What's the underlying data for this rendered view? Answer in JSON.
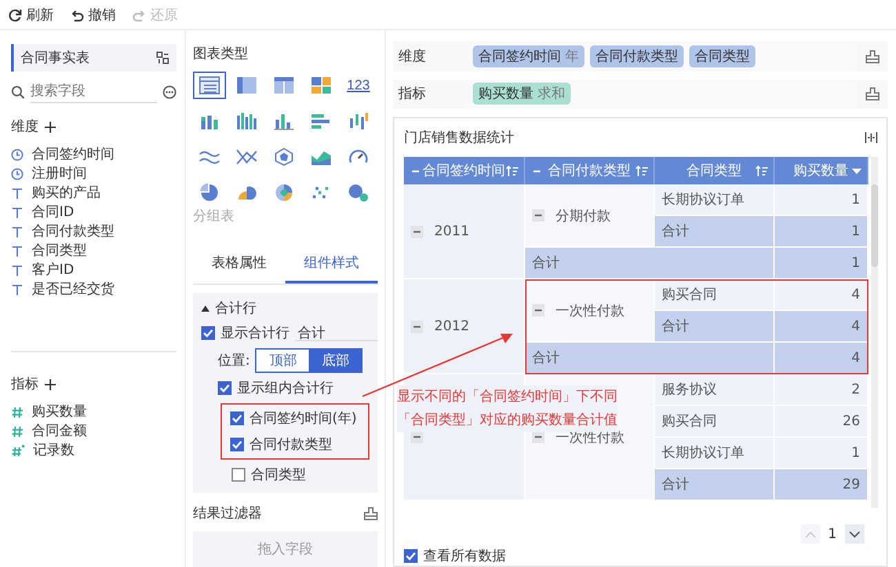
{
  "toolbar": [
    {
      "kind": "refresh",
      "label": "刷新",
      "disabled": false
    },
    {
      "kind": "undo",
      "label": "撤销",
      "disabled": false
    },
    {
      "kind": "redo",
      "label": "还原",
      "disabled": true
    }
  ],
  "fields_panel": {
    "table_name": "合同事实表",
    "search": {
      "placeholder": "搜索字段"
    },
    "dimensions": {
      "title": "维度",
      "items": [
        {
          "kind": "date",
          "label": "合同签约时间"
        },
        {
          "kind": "date",
          "label": "注册时间"
        },
        {
          "kind": "text",
          "label": "购买的产品"
        },
        {
          "kind": "text",
          "label": "合同ID"
        },
        {
          "kind": "text",
          "label": "合同付款类型"
        },
        {
          "kind": "text",
          "label": "合同类型"
        },
        {
          "kind": "text",
          "label": "客户ID"
        },
        {
          "kind": "text",
          "label": "是否已经交货"
        }
      ]
    },
    "measures": {
      "title": "指标",
      "items": [
        {
          "kind": "number",
          "label": "购买数量"
        },
        {
          "kind": "number",
          "label": "合同金额"
        },
        {
          "kind": "count",
          "label": "记录数"
        }
      ]
    }
  },
  "settings_panel": {
    "chart_type_title": "图表类型",
    "chart_types": [
      {
        "kind": "table",
        "selected": true
      },
      {
        "kind": "grouped-table",
        "selected": false
      },
      {
        "kind": "detail-table",
        "selected": false
      },
      {
        "kind": "tiles",
        "selected": false
      },
      {
        "kind": "number",
        "label": "123",
        "selected": false
      },
      {
        "kind": "stacked-bar",
        "selected": false
      },
      {
        "kind": "multi-bar",
        "selected": false
      },
      {
        "kind": "column",
        "selected": false
      },
      {
        "kind": "horizontal-bar",
        "selected": false
      },
      {
        "kind": "range-bar",
        "selected": false
      },
      {
        "kind": "line",
        "selected": false
      },
      {
        "kind": "cross-line",
        "selected": false
      },
      {
        "kind": "radar",
        "selected": false
      },
      {
        "kind": "area",
        "selected": false
      },
      {
        "kind": "gauge",
        "selected": false
      },
      {
        "kind": "pie",
        "selected": false
      },
      {
        "kind": "rose",
        "selected": false
      },
      {
        "kind": "sunburst",
        "selected": false
      },
      {
        "kind": "scatter",
        "selected": false
      },
      {
        "kind": "bubble",
        "selected": false
      }
    ],
    "tooltip": "分组表",
    "tabs": [
      {
        "label": "表格属性",
        "selected": false
      },
      {
        "label": "组件样式",
        "selected": true
      }
    ],
    "section": {
      "title": "合计行",
      "expanded": true
    },
    "show_total": {
      "label": "显示合计行",
      "checked": true,
      "value": "合计"
    },
    "position": {
      "label": "位置:",
      "options": [
        {
          "label": "顶部",
          "selected": false
        },
        {
          "label": "底部",
          "selected": true
        }
      ]
    },
    "group_total": {
      "label": "显示组内合计行",
      "checked": true,
      "children": [
        {
          "label": "合同签约时间(年)",
          "checked": true,
          "highlighted": true
        },
        {
          "label": "合同付款类型",
          "checked": true,
          "highlighted": true
        },
        {
          "label": "合同类型",
          "checked": false,
          "highlighted": false
        }
      ]
    },
    "filter": {
      "title": "结果过滤器",
      "placeholder": "拖入字段"
    }
  },
  "shelves": [
    {
      "label": "维度",
      "kind": "dimension",
      "tags": [
        {
          "name": "合同签约时间",
          "suffix": "年"
        },
        {
          "name": "合同付款类型"
        },
        {
          "name": "合同类型"
        }
      ]
    },
    {
      "label": "指标",
      "kind": "measure",
      "tags": [
        {
          "name": "购买数量",
          "suffix": "求和"
        }
      ]
    }
  ],
  "card": {
    "title": "门店销售数据统计",
    "table": {
      "columns": [
        {
          "label": "合同签约时间",
          "collapsible": true,
          "kind": "sort"
        },
        {
          "label": "合同付款类型",
          "collapsible": true,
          "kind": "sort"
        },
        {
          "label": "合同类型",
          "collapsible": false,
          "kind": "sort"
        },
        {
          "label": "购买数量",
          "collapsible": false,
          "kind": "menu"
        }
      ],
      "groups": [
        {
          "year": "2011",
          "highlighted": false,
          "payments": [
            {
              "name": "分期付款",
              "items": [
                {
                  "type": "长期协议订单",
                  "count": "1",
                  "total": false
                },
                {
                  "type": "合计",
                  "count": "1",
                  "total": true
                }
              ]
            }
          ],
          "total": {
            "label": "合计",
            "count": "1"
          }
        },
        {
          "year": "2012",
          "highlighted": true,
          "payments": [
            {
              "name": "一次性付款",
              "items": [
                {
                  "type": "购买合同",
                  "count": "4",
                  "total": false
                },
                {
                  "type": "合计",
                  "count": "4",
                  "total": true
                }
              ]
            }
          ],
          "total": {
            "label": "合计",
            "count": "4"
          }
        },
        {
          "highlighted": false,
          "payments": [
            {
              "name": "一次性付款",
              "items": [
                {
                  "type": "服务协议",
                  "count": "2",
                  "total": false
                },
                {
                  "type": "购买合同",
                  "count": "26",
                  "total": false
                },
                {
                  "type": "长期协议订单",
                  "count": "1",
                  "total": false
                },
                {
                  "type": "合计",
                  "count": "29",
                  "total": true
                }
              ]
            }
          ]
        }
      ]
    },
    "pagination": {
      "page": "1",
      "prev_disabled": true
    },
    "view_all": {
      "label": "查看所有数据",
      "checked": true
    }
  },
  "annotation": {
    "lines": [
      "显示不同的「合同签约时间」下不同",
      "「合同类型」对应的购买数量合计值"
    ]
  }
}
